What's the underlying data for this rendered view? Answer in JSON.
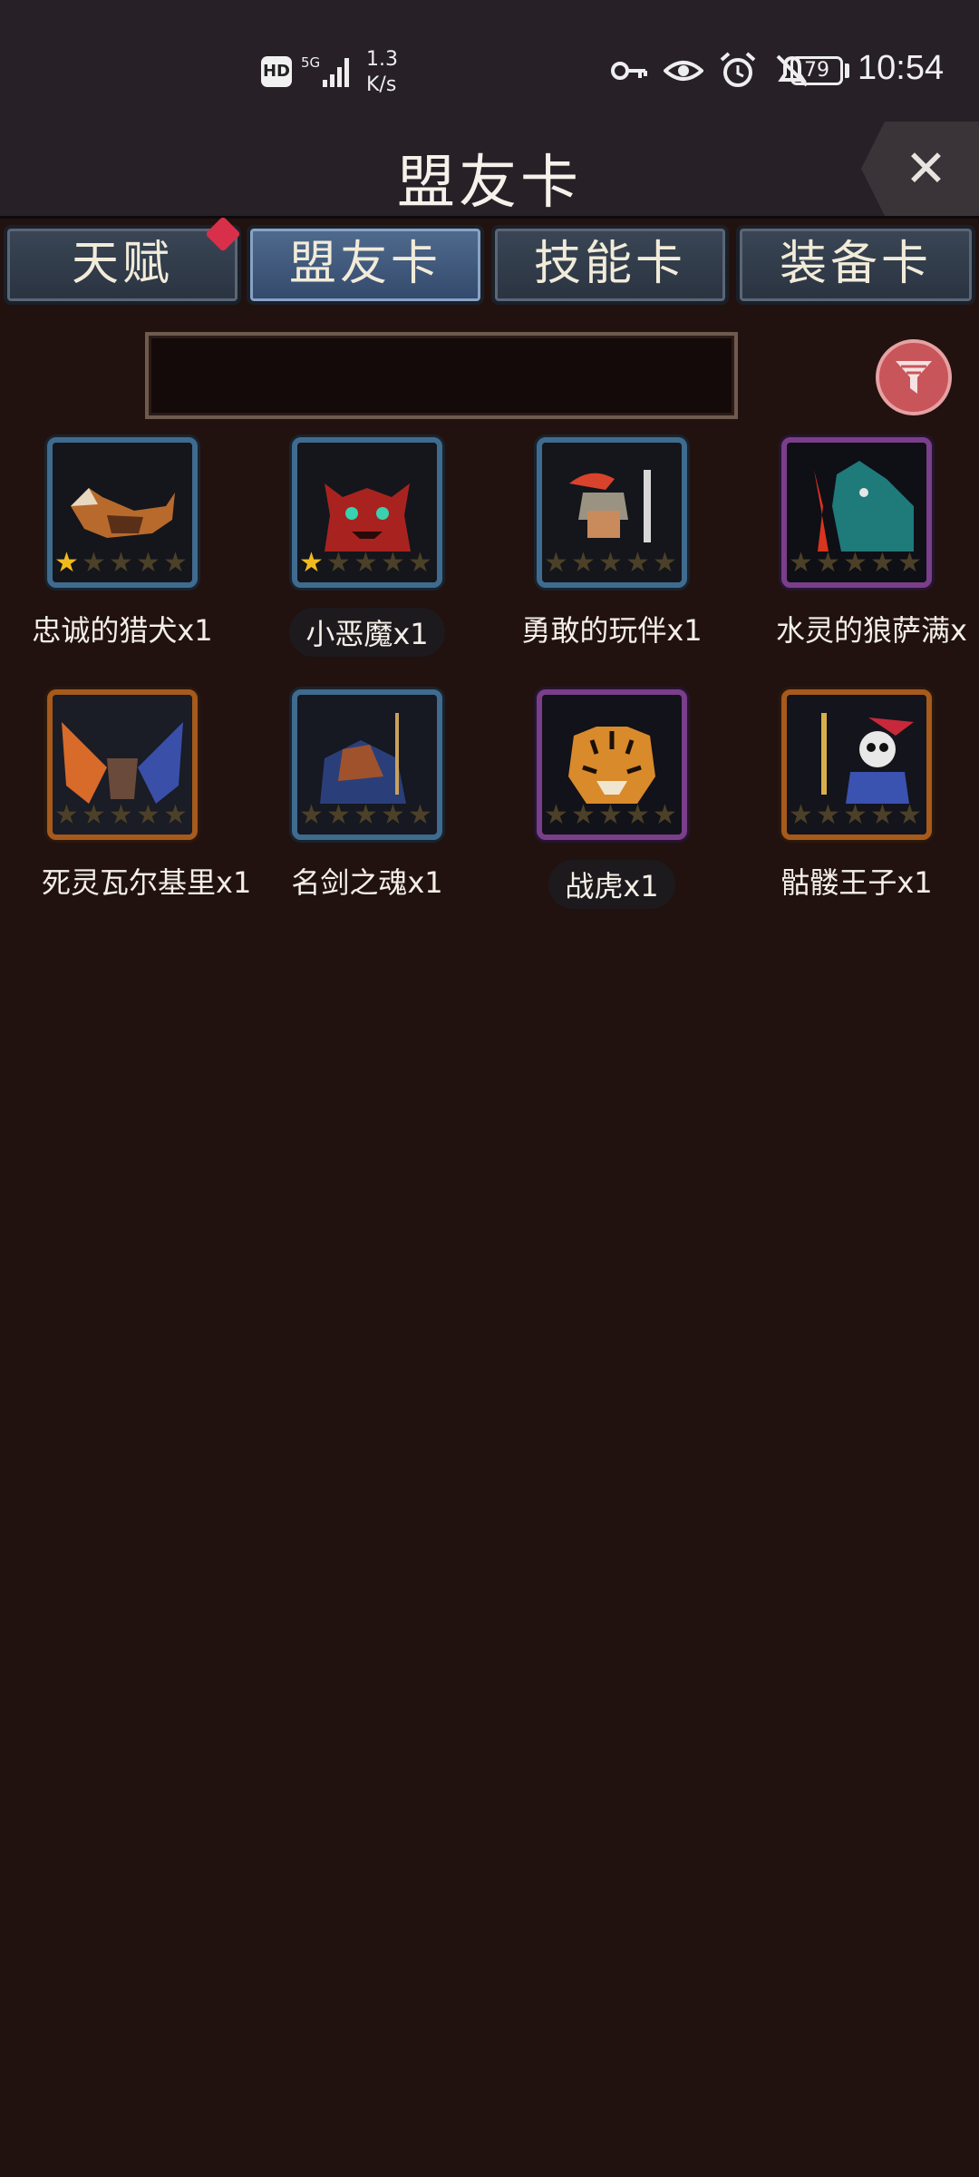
{
  "status_bar": {
    "hd": "HD",
    "network": "5G",
    "speed_value": "1.3",
    "speed_unit": "K/s",
    "battery": "79",
    "time": "10:54",
    "icons": [
      "key-icon",
      "eye-icon",
      "alarm-icon",
      "bell-off-icon"
    ]
  },
  "header": {
    "title": "盟友卡",
    "close_icon": "close-icon"
  },
  "tabs": [
    {
      "label": "天赋",
      "active": false,
      "badge": true
    },
    {
      "label": "盟友卡",
      "active": true,
      "badge": false
    },
    {
      "label": "技能卡",
      "active": false,
      "badge": false
    },
    {
      "label": "装备卡",
      "active": false,
      "badge": false
    }
  ],
  "search": {
    "value": "",
    "placeholder": ""
  },
  "filter": {
    "icon": "filter-icon"
  },
  "cards": [
    {
      "name": "忠诚的猎犬x1",
      "stars": 1,
      "max_stars": 5,
      "rarity": "blue"
    },
    {
      "name": "小恶魔x1",
      "stars": 1,
      "max_stars": 5,
      "rarity": "blue"
    },
    {
      "name": "勇敢的玩伴x1",
      "stars": 0,
      "max_stars": 5,
      "rarity": "blue"
    },
    {
      "name": "水灵的狼萨满x",
      "stars": 0,
      "max_stars": 5,
      "rarity": "purple"
    },
    {
      "name": "死灵瓦尔基里x1",
      "stars": 0,
      "max_stars": 5,
      "rarity": "orange"
    },
    {
      "name": "名剑之魂x1",
      "stars": 0,
      "max_stars": 5,
      "rarity": "blue"
    },
    {
      "name": "战虎x1",
      "stars": 0,
      "max_stars": 5,
      "rarity": "purple"
    },
    {
      "name": "骷髅王子x1",
      "stars": 0,
      "max_stars": 5,
      "rarity": "orange"
    }
  ],
  "colors": {
    "background": "#211210",
    "active_tab": "#4f6b8e",
    "badge": "#d8304a",
    "filter": "#c8555a",
    "star_on": "#f2b91e"
  }
}
